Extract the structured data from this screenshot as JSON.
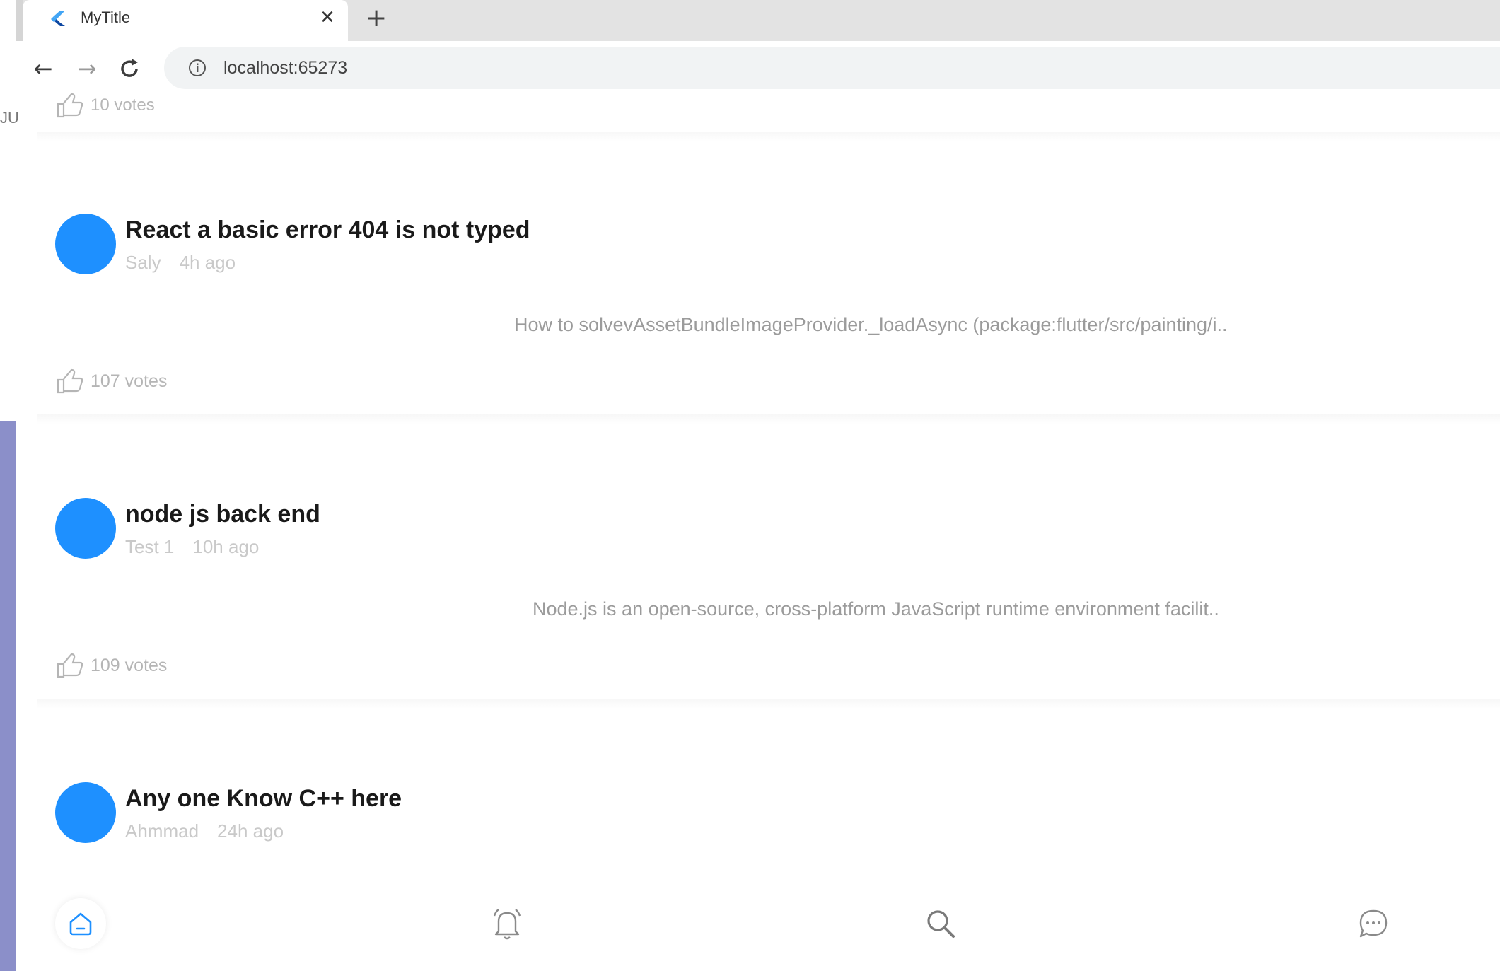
{
  "browser": {
    "tab_title": "MyTitle",
    "tab_close_symbol": "✕",
    "new_tab_symbol": "+",
    "url": "localhost:65273",
    "back_symbol": "←",
    "forward_symbol": "→",
    "reload_symbol": "C"
  },
  "side_fragment": "JU",
  "partial_post": {
    "votes": "10 votes"
  },
  "posts": [
    {
      "title": "React a basic error 404 is not typed",
      "author": "Saly",
      "time": "4h ago",
      "body": "How to solvevAssetBundleImageProvider._loadAsync (package:flutter/src/painting/i..",
      "votes": "107 votes"
    },
    {
      "title": "node js back end",
      "author": "Test 1",
      "time": "10h ago",
      "body": "Node.js is an open-source, cross-platform JavaScript runtime environment facilit..",
      "votes": "109 votes"
    },
    {
      "title": "Any one Know C++  here",
      "author": "Ahmmad",
      "time": "24h ago"
    }
  ],
  "bottom_nav": {
    "items": [
      "home-icon",
      "notification-bell-icon",
      "search-icon",
      "chat-icon"
    ]
  },
  "colors": {
    "avatar": "#1e90ff",
    "frame": "#8b8fc9"
  }
}
